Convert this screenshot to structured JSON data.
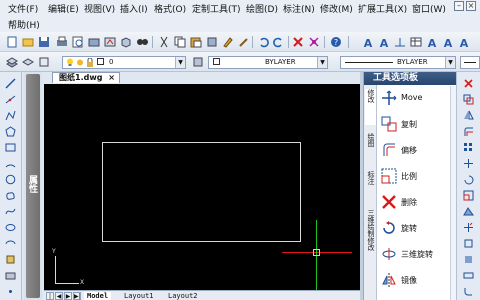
{
  "menu": {
    "items": [
      "文件(F)",
      "编辑(E)",
      "视图(V)",
      "插入(I)",
      "格式(O)",
      "定制工具(T)",
      "绘图(D)",
      "标注(N)",
      "修改(M)",
      "扩展工具(X)",
      "窗口(W)",
      "帮助(H)"
    ]
  },
  "toolbar": {
    "layer_value": "0",
    "color_value": "BYLAYER",
    "linetype_value": "BYLAYER",
    "icons": [
      "new-icon",
      "open-icon",
      "save-icon",
      "print-icon",
      "print-preview-icon",
      "publish-icon",
      "find-icon",
      "cut-icon",
      "copy-icon",
      "paste-icon",
      "match-properties-icon",
      "undo-icon",
      "redo-icon",
      "delete-icon",
      "purge-icon",
      "help-icon",
      "text-style-icon",
      "dim-style-icon"
    ]
  },
  "properties": {
    "label": "属性"
  },
  "document": {
    "tab_title": "图纸1.dwg",
    "close": "×",
    "ucs_x": "X",
    "ucs_y": "Y",
    "layouts": [
      "Model",
      "Layout1",
      "Layout2"
    ]
  },
  "palette": {
    "title": "工具选项板",
    "side_tabs": [
      "修改",
      "绘图",
      "标注",
      "三维绘制修改"
    ],
    "tools": [
      {
        "label": "Move",
        "icon": "move-icon"
      },
      {
        "label": "复制",
        "icon": "copy-icon"
      },
      {
        "label": "偏移",
        "icon": "offset-icon"
      },
      {
        "label": "比例",
        "icon": "scale-icon"
      },
      {
        "label": "删除",
        "icon": "erase-icon"
      },
      {
        "label": "旋转",
        "icon": "rotate-icon"
      },
      {
        "label": "三维旋转",
        "icon": "rotate-3d-icon"
      },
      {
        "label": "镜像",
        "icon": "mirror-icon"
      }
    ]
  },
  "colors": {
    "canvas": "#000000",
    "palette_header": "#2f4f7a",
    "crosshair_x": "#e01414",
    "crosshair_y": "#18c418"
  }
}
